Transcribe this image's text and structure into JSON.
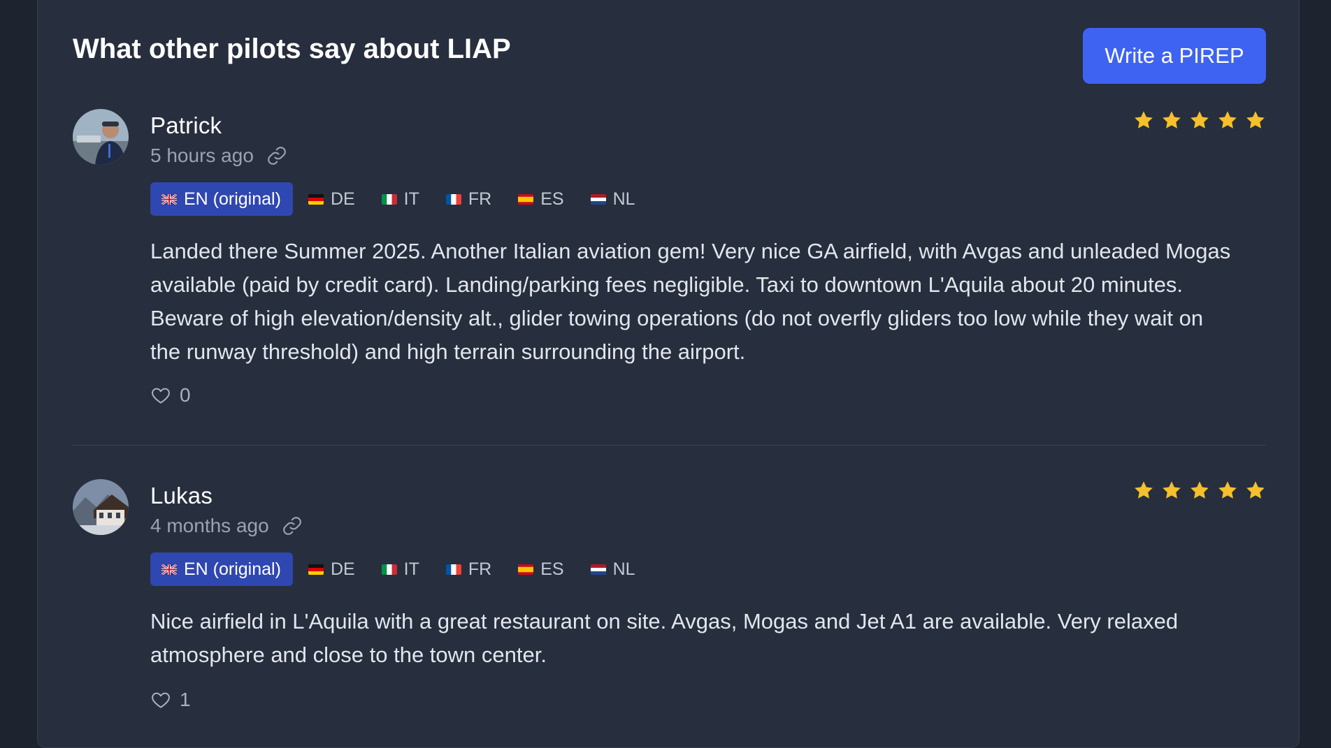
{
  "header": {
    "title": "What other pilots say about LIAP",
    "write_button": "Write a PIREP"
  },
  "colors": {
    "accent": "#3e63f3",
    "star": "#f5c02b",
    "active_lang_bg": "#2f47b0"
  },
  "languages": [
    {
      "code": "EN (original)",
      "flag": "uk-flag-icon"
    },
    {
      "code": "DE",
      "flag": "germany-flag-icon"
    },
    {
      "code": "IT",
      "flag": "italy-flag-icon"
    },
    {
      "code": "FR",
      "flag": "france-flag-icon"
    },
    {
      "code": "ES",
      "flag": "spain-flag-icon"
    },
    {
      "code": "NL",
      "flag": "netherlands-flag-icon"
    }
  ],
  "reviews": [
    {
      "author": "Patrick",
      "time": "5 hours ago",
      "rating": 5,
      "text": "Landed there Summer 2025. Another Italian aviation gem! Very nice GA airfield, with Avgas and unleaded Mogas available (paid by credit card). Landing/parking fees negligible. Taxi to downtown L'Aquila about 20 minutes. Beware of high elevation/density alt., glider towing operations (do not overfly gliders too low while they wait on the runway threshold) and high terrain surrounding the airport.",
      "likes": "0"
    },
    {
      "author": "Lukas",
      "time": "4 months ago",
      "rating": 5,
      "text": "Nice airfield in L'Aquila with a great restaurant on site. Avgas, Mogas and Jet A1 are available. Very relaxed atmosphere and close to the town center.",
      "likes": "1"
    }
  ]
}
